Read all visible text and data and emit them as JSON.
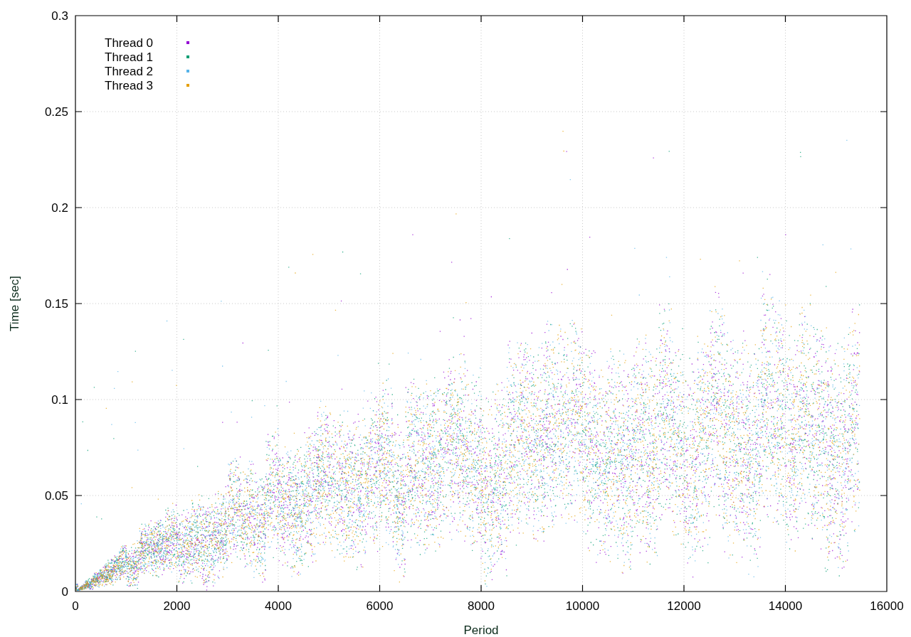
{
  "plot": {
    "x_axis_title": "Period",
    "y_axis_title": "Time [sec]",
    "x_tick_labels": [
      "0",
      "2000",
      "4000",
      "6000",
      "8000",
      "10000",
      "12000",
      "14000",
      "16000"
    ],
    "y_tick_labels": [
      "0.3",
      "0.25",
      "0.2",
      "0.15",
      "0.1",
      "0.05",
      "0"
    ],
    "legend": [
      {
        "label": "Thread 0",
        "color": "#9400d3"
      },
      {
        "label": "Thread 1",
        "color": "#009e73"
      },
      {
        "label": "Thread 2",
        "color": "#56b4e9"
      },
      {
        "label": "Thread 3",
        "color": "#e69f00"
      }
    ]
  }
}
